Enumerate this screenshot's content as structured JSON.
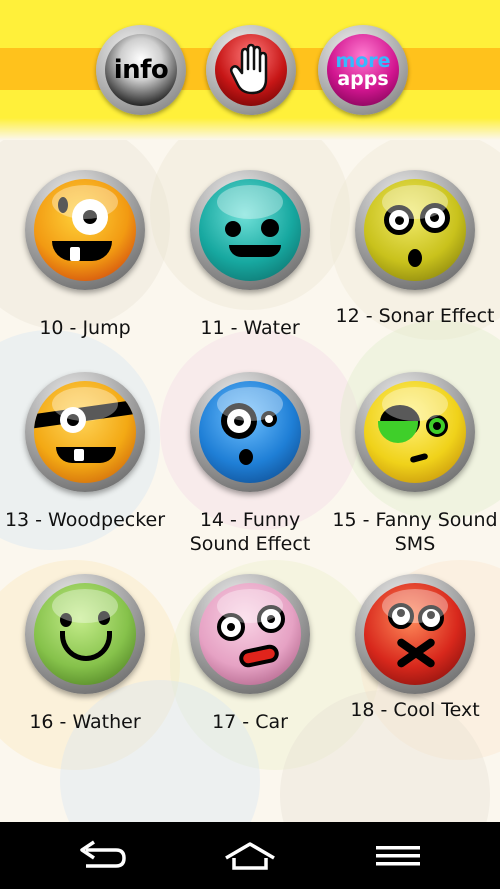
{
  "top_buttons": {
    "info_label": "info",
    "more_label": "more",
    "apps_label": "apps"
  },
  "sounds": [
    {
      "label": "10 - Jump",
      "color": "#f29a12"
    },
    {
      "label": "11 - Water",
      "color": "#17a8a0"
    },
    {
      "label": "12 - Sonar Effect",
      "color": "#c9c21c"
    },
    {
      "label": "13 - Woodpecker",
      "color": "#f3a914"
    },
    {
      "label": "14 - Funny Sound Effect",
      "color": "#1f7fd6"
    },
    {
      "label": "15 - Fanny Sound SMS",
      "color": "#f0d21a"
    },
    {
      "label": "16 - Wather",
      "color": "#86c24b"
    },
    {
      "label": "17 - Car",
      "color": "#e6a2c4"
    },
    {
      "label": "18 - Cool Text",
      "color": "#d8281c"
    }
  ],
  "icons": {
    "stop": "hand-stop-icon",
    "back": "back-arrow-icon",
    "home": "home-icon",
    "menu": "menu-icon"
  },
  "colors": {
    "top_bar": "#fff03a",
    "top_stripe": "#ffc21c",
    "nav_bar": "#000000"
  }
}
